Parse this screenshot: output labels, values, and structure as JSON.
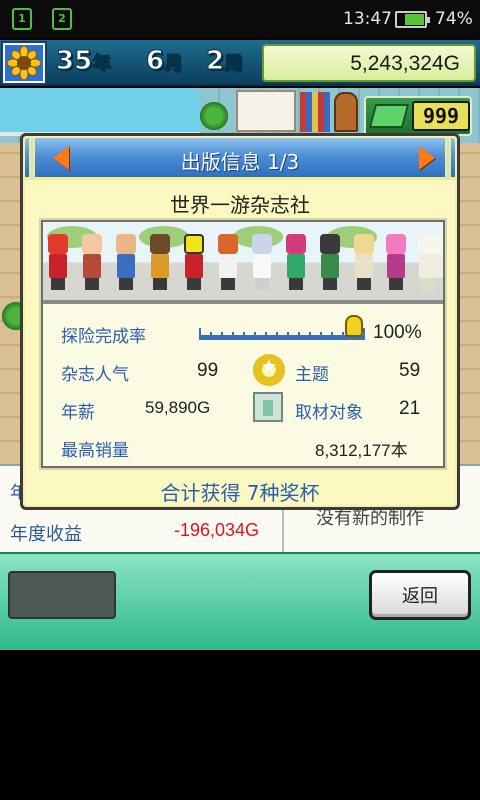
{
  "status_bar": {
    "sim1": "1",
    "sim2": "2",
    "time": "13:47",
    "battery_level": 0.74,
    "battery_pct": "74%"
  },
  "game_header": {
    "year": "35",
    "year_unit": "年",
    "month": "6",
    "month_unit": "月",
    "week": "2",
    "week_unit": "周",
    "money": "5,243,324G",
    "gems": "999",
    "logo_icon": "sunflower-icon"
  },
  "dialog": {
    "title": "出版信息 1/3",
    "company": "世界一游杂志社",
    "stats": {
      "exploration_label": "探险完成率",
      "exploration_value": "100%",
      "exploration_progress": 1.0,
      "popularity_label": "杂志人气",
      "popularity_value": "99",
      "theme_label": "主题",
      "theme_value": "59",
      "salary_label": "年薪",
      "salary_value": "59,890G",
      "interview_label": "取材对象",
      "interview_value": "21",
      "max_sales_label": "最高销量",
      "max_sales_value": "8,312,177本"
    },
    "trophy_text": "合计获得  7种奖杯"
  },
  "background_info": {
    "cut_label": "年",
    "annual_label": "年度收益",
    "annual_value": "-196,034G",
    "note": "没有新的制作"
  },
  "bottom": {
    "back_label": "返回"
  },
  "colors": {
    "accent_blue": "#2a5fb0",
    "negative": "#e0121e",
    "dialog_bg": "#fbf8c2",
    "header_blue": "#4e8fd6",
    "arrow_orange": "#ff7a12"
  }
}
